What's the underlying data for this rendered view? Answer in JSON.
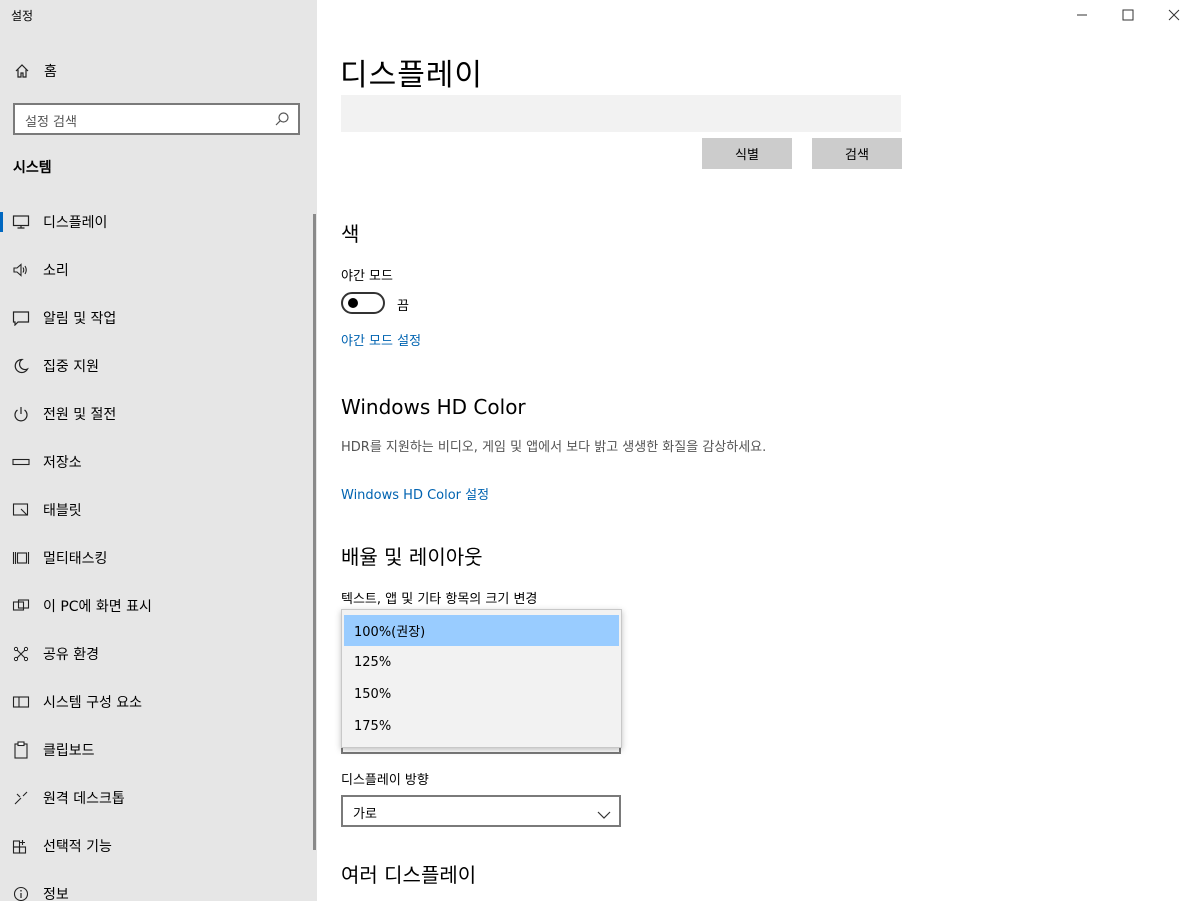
{
  "window": {
    "title": "설정",
    "controls": [
      "minimize",
      "maximize",
      "close"
    ]
  },
  "sidebar": {
    "home_label": "홈",
    "search_placeholder": "설정 검색",
    "section": "시스템",
    "items": [
      {
        "label": "디스플레이",
        "icon": "monitor-icon",
        "active": true
      },
      {
        "label": "소리",
        "icon": "speaker-icon"
      },
      {
        "label": "알림 및 작업",
        "icon": "notification-icon"
      },
      {
        "label": "집중 지원",
        "icon": "moon-icon"
      },
      {
        "label": "전원 및 절전",
        "icon": "power-icon"
      },
      {
        "label": "저장소",
        "icon": "storage-icon"
      },
      {
        "label": "태블릿",
        "icon": "tablet-icon"
      },
      {
        "label": "멀티태스킹",
        "icon": "multitasking-icon"
      },
      {
        "label": "이 PC에 화면 표시",
        "icon": "project-icon"
      },
      {
        "label": "공유 환경",
        "icon": "share-icon"
      },
      {
        "label": "시스템 구성 요소",
        "icon": "components-icon"
      },
      {
        "label": "클립보드",
        "icon": "clipboard-icon"
      },
      {
        "label": "원격 데스크톱",
        "icon": "remote-desktop-icon"
      },
      {
        "label": "선택적 기능",
        "icon": "optional-features-icon"
      },
      {
        "label": "정보",
        "icon": "info-icon"
      }
    ]
  },
  "main": {
    "title": "디스플레이",
    "identify_button": "식별",
    "detect_button": "검색",
    "color": {
      "heading": "색",
      "night_light_label": "야간 모드",
      "night_light_state": "끔",
      "night_light_settings_link": "야간 모드 설정"
    },
    "hdr": {
      "heading": "Windows HD Color",
      "description": "HDR를 지원하는 비디오, 게임 및 앱에서 보다 밝고 생생한 화질을 감상하세요.",
      "settings_link": "Windows HD Color 설정"
    },
    "scale": {
      "heading": "배율 및 레이아웃",
      "size_label": "텍스트, 앱 및 기타 항목의 크기 변경",
      "options": [
        "100%(권장)",
        "125%",
        "150%",
        "175%"
      ],
      "selected_index": 0
    },
    "orientation": {
      "label": "디스플레이 방향",
      "value": "가로"
    },
    "multiple_displays_heading": "여러 디스플레이"
  }
}
